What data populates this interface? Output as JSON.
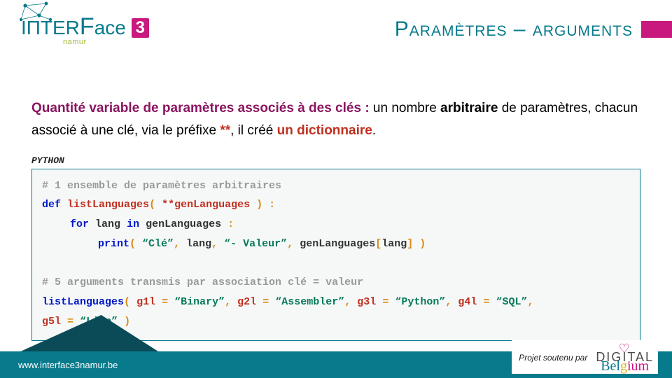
{
  "logo": {
    "part1": "IП",
    "part2": "TER",
    "cap": "F",
    "part3": "ace",
    "three": "3",
    "sub": "namur"
  },
  "title": "Paramètres – arguments",
  "desc": {
    "s1": "Quantité variable de paramètres",
    "s2": "associés à des clés :",
    "s3": "un nombre",
    "s4": "arbitraire",
    "s5": "de paramètres, chacun associé à une clé, via le préfixe",
    "s6": "**",
    "s7": ", il créé",
    "s8": "un dictionnaire",
    "s9": "."
  },
  "code_label": "PYTHON",
  "code": {
    "c1": "# 1 ensemble de paramètres arbitraires",
    "l2": {
      "def": "def",
      "fn": "listLanguages",
      "p1": "(",
      "star": "**genLanguages",
      "p2": ")",
      "colon": ":"
    },
    "l3": {
      "for": "for",
      "id1": "lang",
      "in": "in",
      "id2": "genLanguages",
      "colon": ":"
    },
    "l4": {
      "print": "print",
      "p1": "(",
      "s1": "“Clé”",
      "c": ",",
      "id1": "lang",
      "s2": "“- Valeur”",
      "id2": "genLanguages",
      "br1": "[",
      "id3": "lang",
      "br2": "]",
      "p2": ")"
    },
    "c5a": "# 5 arguments transmis par association",
    "c5b": "clé = valeur",
    "l6": {
      "fn": "listLanguages",
      "p1": "(",
      "k1": "g1l",
      "eq": "=",
      "v1": "“Binary”",
      "k2": "g2l",
      "v2": "“Assembler”",
      "k3": "g3l",
      "v3": "“Python”",
      "k4": "g4l",
      "v4": "“SQL”",
      "k5": "g5l",
      "v5": "“Lisp”",
      "p2": ")",
      "c": ","
    }
  },
  "footer": {
    "url": "www.interface3namur.be",
    "sponsor": "Projet soutenu par",
    "digital": "DIGITAL",
    "belgium": "Belgium"
  }
}
